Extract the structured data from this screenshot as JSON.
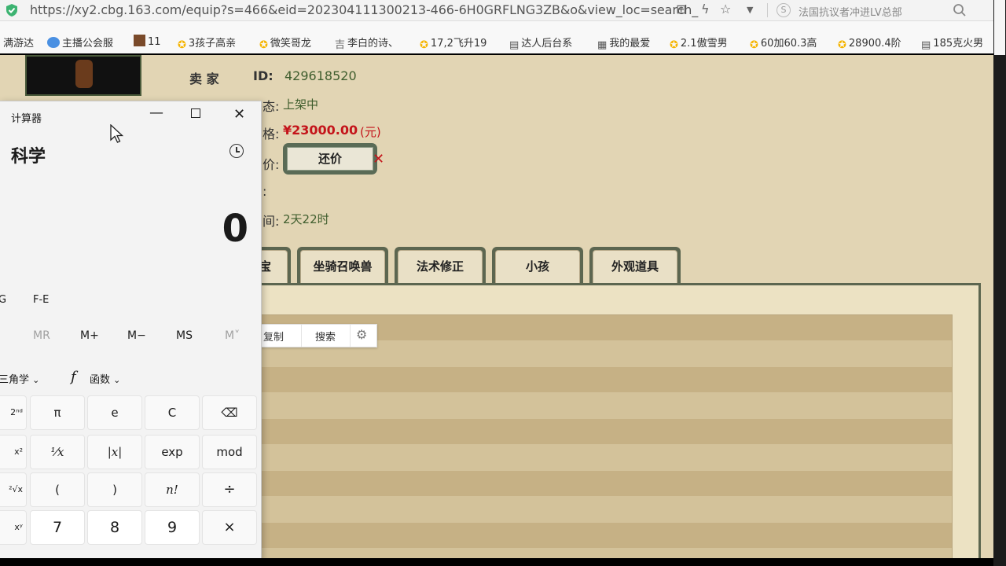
{
  "browser": {
    "url": "https://xy2.cbg.163.com/equip?s=466&eid=202304111300213-466-6H0GRFLNG3ZB&o&view_loc=search_",
    "news_text": "法国抗议者冲进LV总部",
    "bookmarks": [
      {
        "label": "满游达",
        "icon": "game-icon"
      },
      {
        "label": "主播公会服",
        "icon": "bird-icon"
      },
      {
        "label": "11",
        "icon": "game-avatar-icon"
      },
      {
        "label": "3孩子高亲",
        "icon": "chick-icon"
      },
      {
        "label": "微笑哥龙",
        "icon": "chick-icon"
      },
      {
        "label": "李白的诗、",
        "icon": "ancient-icon"
      },
      {
        "label": "17,2飞升19",
        "icon": "chick-icon"
      },
      {
        "label": "达人后台系",
        "icon": "doc-icon"
      },
      {
        "label": "我的最爱",
        "icon": "grid-icon"
      },
      {
        "label": "2.1傲雪男",
        "icon": "chick-icon"
      },
      {
        "label": "60加60.3高",
        "icon": "chick-icon"
      },
      {
        "label": "28900.4阶",
        "icon": "chick-icon"
      },
      {
        "label": "185克火男",
        "icon": "doc-icon"
      }
    ]
  },
  "listing": {
    "seller_label": "卖 家",
    "id_label": "ID:",
    "seller_id": "429618520",
    "status_label_fragment": "态:",
    "status_value": "上架中",
    "price_label_fragment": "格:",
    "price_value": "¥23000.00",
    "price_unit": "(元)",
    "bargain_label_fragment": "价:",
    "bargain_button": "还价",
    "remark_label_fragment": ":",
    "time_label_fragment": "间:",
    "time_value": "2天22时",
    "tabs": [
      "宝",
      "坐骑召唤兽",
      "法术修正",
      "小孩",
      "外观道具"
    ],
    "context_menu": [
      "复制",
      "搜索"
    ]
  },
  "calculator": {
    "title": "计算器",
    "mode": "科学",
    "display": "0",
    "angle_partial": "G",
    "fe": "F-E",
    "memory": [
      "MR",
      "M+",
      "M−",
      "MS",
      "M˅"
    ],
    "trig": "三角学",
    "func_symbol": "f",
    "func": "函数",
    "rows": [
      [
        "2ⁿᵈ",
        "π",
        "e",
        "C",
        "⌫"
      ],
      [
        "x²",
        "¹⁄x",
        "|x|",
        "exp",
        "mod"
      ],
      [
        "²√x",
        "(",
        ")",
        "n!",
        "÷"
      ],
      [
        "xʸ",
        "7",
        "8",
        "9",
        "×"
      ]
    ]
  }
}
